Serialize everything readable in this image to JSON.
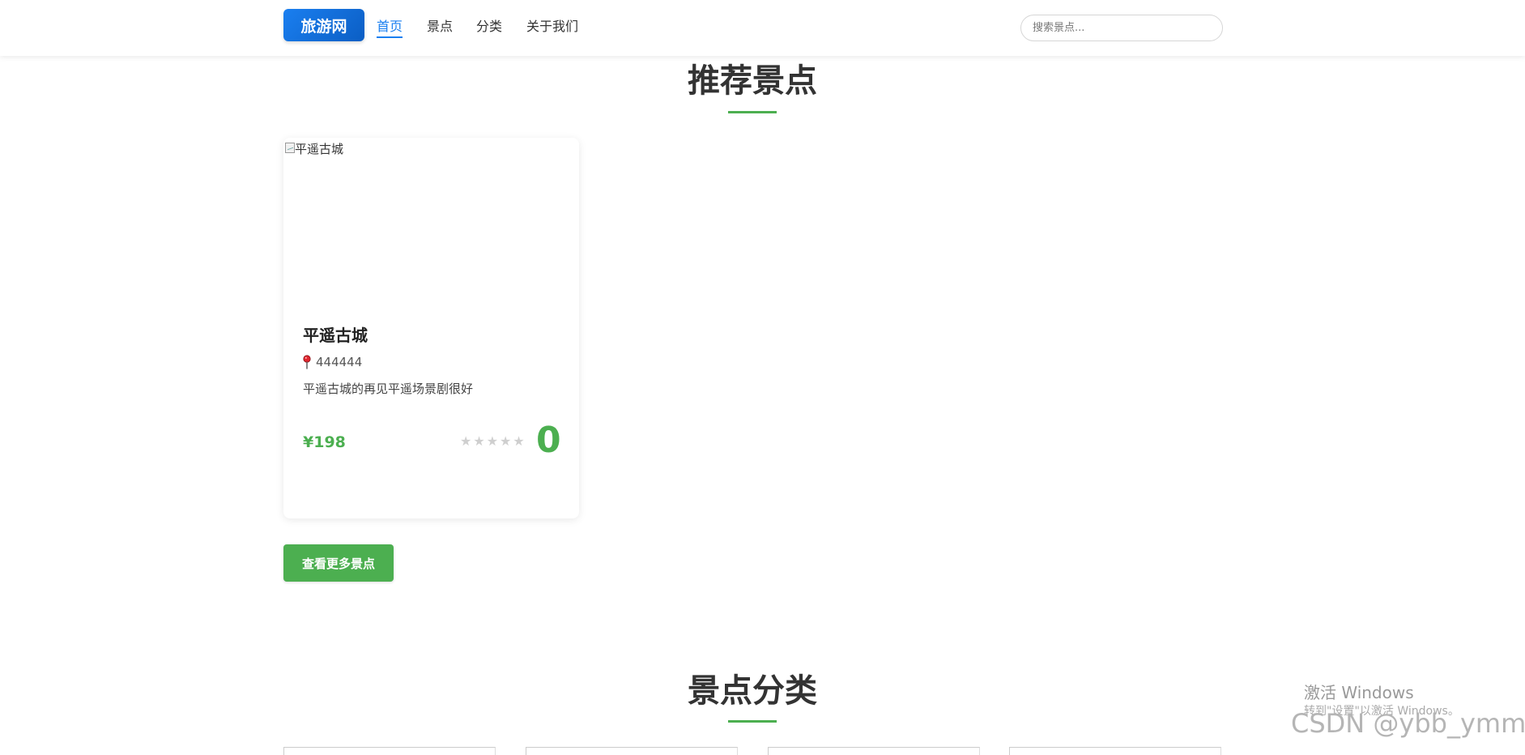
{
  "nav": {
    "logo": "旅游网",
    "links": [
      {
        "label": "首页",
        "active": true
      },
      {
        "label": "景点",
        "active": false
      },
      {
        "label": "分类",
        "active": false
      },
      {
        "label": "关于我们",
        "active": false
      }
    ],
    "search_placeholder": "搜索景点..."
  },
  "recommended": {
    "title": "推荐景点",
    "more_button": "查看更多景点",
    "cards": [
      {
        "image_alt": "平遥古城",
        "name": "平遥古城",
        "location": "444444",
        "description": "平遥古城的再见平遥场景剧很好",
        "price": "¥198",
        "stars_filled": 0,
        "stars_total": 5,
        "rating": "0"
      }
    ]
  },
  "categories": {
    "title": "景点分类"
  },
  "watermark": {
    "activate_title": "激活 Windows",
    "activate_hint": "转到\"设置\"以激活 Windows。",
    "csdn": "CSDN @ybb_ymm"
  },
  "colors": {
    "brand": "#1a7ff0",
    "accent": "#4caf50",
    "star_empty": "#cfcfcf"
  }
}
